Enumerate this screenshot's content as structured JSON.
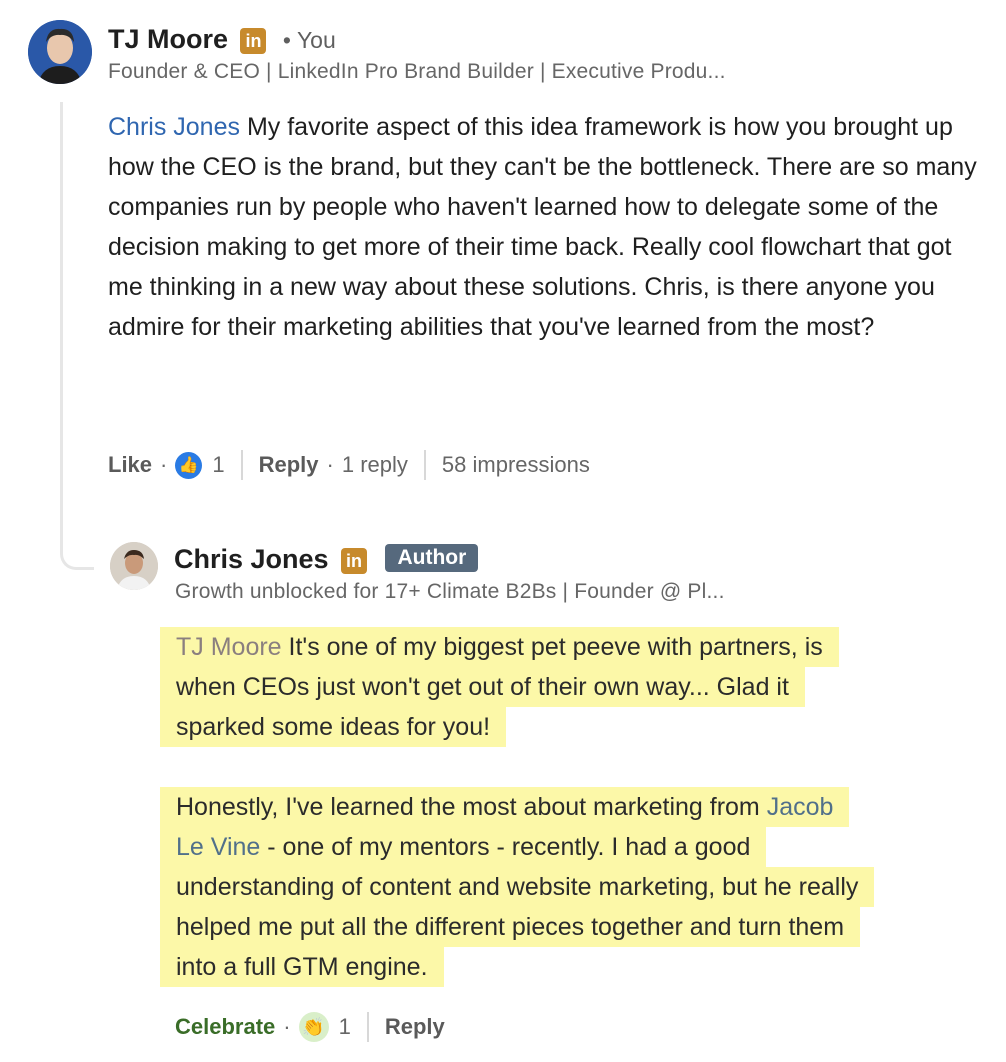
{
  "comment": {
    "author": "TJ Moore",
    "you_label": "• You",
    "headline": "Founder & CEO | LinkedIn Pro Brand Builder | Executive Produ...",
    "mention": "Chris Jones",
    "body": " My favorite aspect of this idea framework is how you brought up how the CEO is the brand, but they can't be the bottleneck. There are so many companies run by people who haven't learned how to delegate some of the decision making to get more of their time back. Really cool flowchart that got me thinking in a new way about these solutions. Chris, is there anyone you admire for their marketing abilities that you've learned from the most?",
    "actions": {
      "like": "Like",
      "like_count": "1",
      "reply": "Reply",
      "reply_count": "1 reply",
      "impressions": "58 impressions"
    }
  },
  "reply": {
    "author": "Chris Jones",
    "badge": "Author",
    "headline": "Growth unblocked for 17+ Climate B2Bs | Founder @ Pl...",
    "p1": {
      "mention": "TJ Moore",
      "line1": " It's one of my biggest pet peeve with partners, is",
      "line2": "when CEOs just won't get out of their own way... Glad it",
      "line3": "sparked some ideas for you!"
    },
    "p2": {
      "line1_a": "Honestly, I've learned the most about marketing from ",
      "mention_a": "Jacob",
      "mention_b": "Le Vine",
      "line2_b": " - one of my mentors - recently. I had a good",
      "line3": "understanding of content and website marketing, but he really",
      "line4": "helped me put all the different pieces together and turn them",
      "line5": "into a full GTM engine."
    },
    "actions": {
      "celebrate": "Celebrate",
      "celebrate_count": "1",
      "reply": "Reply"
    }
  },
  "icons": {
    "linkedin_badge": "in",
    "like_reaction": "thumbs-up-icon",
    "celebrate_reaction": "clapping-hands-icon"
  },
  "colors": {
    "mention_blue": "#2f66b0",
    "highlight": "#fcf8a8",
    "linkedin_gold": "#c78a2c",
    "author_badge": "#56697d"
  }
}
